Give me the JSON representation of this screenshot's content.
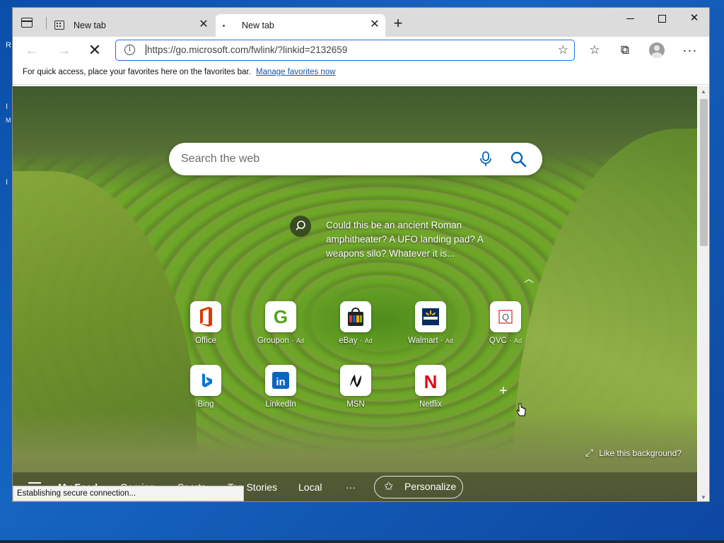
{
  "desktop": {
    "edge_letters": [
      "R",
      "I",
      "M",
      "I"
    ]
  },
  "tabs": [
    {
      "title": "New tab",
      "active": false
    },
    {
      "title": "New tab",
      "active": true
    }
  ],
  "window": {
    "minimize": "—",
    "maximize": "☐",
    "close": "✕"
  },
  "toolbar": {
    "back": "←",
    "forward": "→",
    "stop": "✕",
    "url": "https://go.microsoft.com/fwlink/?linkid=2132659",
    "more": "···"
  },
  "favorites_bar": {
    "hint": "For quick access, place your favorites here on the favorites bar.",
    "link": "Manage favorites now"
  },
  "search": {
    "placeholder": "Search the web"
  },
  "story": {
    "text": "Could this be an ancient Roman amphitheater? A UFO landing pad? A weapons silo? Whatever it is..."
  },
  "tiles": [
    {
      "label": "Office",
      "ad": "",
      "icon": "office-icon",
      "color": "#d83b01"
    },
    {
      "label": "Groupon",
      "ad": "Ad",
      "icon": "groupon-icon",
      "color": "#53a318"
    },
    {
      "label": "eBay",
      "ad": "Ad",
      "icon": "ebay-icon",
      "color": "#e53238"
    },
    {
      "label": "Walmart",
      "ad": "Ad",
      "icon": "walmart-icon",
      "color": "#0071ce"
    },
    {
      "label": "QVC",
      "ad": "Ad",
      "icon": "qvc-icon",
      "color": "#555555"
    },
    {
      "label": "Bing",
      "ad": "",
      "icon": "bing-icon",
      "color": "#0078d4"
    },
    {
      "label": "LinkedIn",
      "ad": "",
      "icon": "linkedin-icon",
      "color": "#0a66c2"
    },
    {
      "label": "MSN",
      "ad": "",
      "icon": "msn-icon",
      "color": "#111111"
    },
    {
      "label": "Netflix",
      "ad": "",
      "icon": "netflix-icon",
      "color": "#e50914"
    }
  ],
  "background": {
    "like_label": "Like this background?"
  },
  "feed_nav": {
    "items": [
      "My Feed",
      "Gaming",
      "Sports",
      "Top Stories",
      "Local"
    ],
    "more": "···",
    "personalize": "Personalize"
  },
  "status": {
    "text": "Establishing secure connection..."
  }
}
